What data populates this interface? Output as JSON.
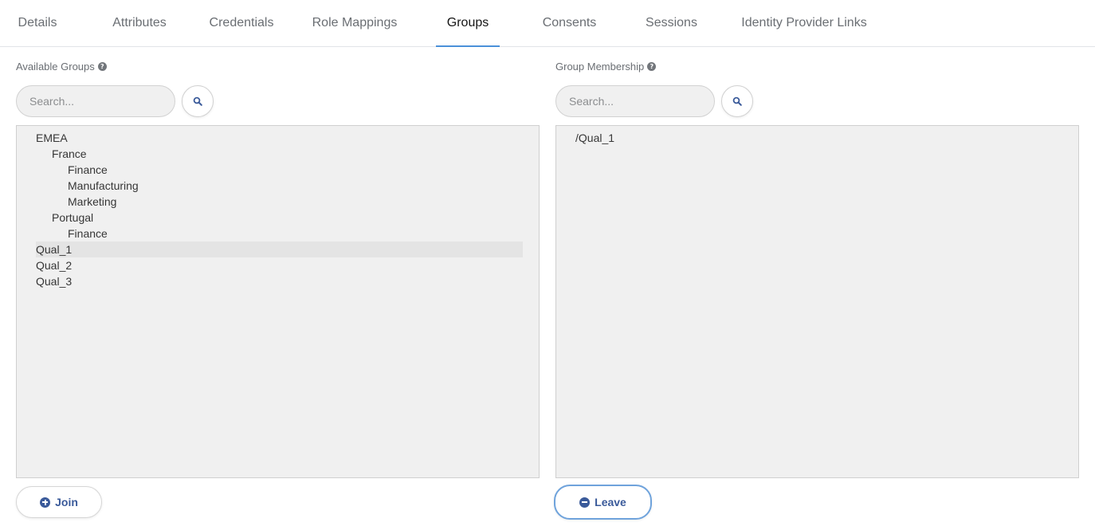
{
  "tabs": [
    {
      "label": "Details"
    },
    {
      "label": "Attributes"
    },
    {
      "label": "Credentials"
    },
    {
      "label": "Role Mappings"
    },
    {
      "label": "Groups",
      "active": true
    },
    {
      "label": "Consents"
    },
    {
      "label": "Sessions"
    },
    {
      "label": "Identity Provider Links"
    }
  ],
  "available_groups": {
    "label": "Available Groups",
    "help_icon": "question-circle-icon",
    "search_placeholder": "Search...",
    "search_icon": "search-icon",
    "items": [
      {
        "label": "EMEA",
        "depth": 0,
        "selected": false
      },
      {
        "label": "France",
        "depth": 1,
        "selected": false
      },
      {
        "label": "Finance",
        "depth": 2,
        "selected": false
      },
      {
        "label": "Manufacturing",
        "depth": 2,
        "selected": false
      },
      {
        "label": "Marketing",
        "depth": 2,
        "selected": false
      },
      {
        "label": "Portugal",
        "depth": 1,
        "selected": false
      },
      {
        "label": "Finance",
        "depth": 2,
        "selected": false
      },
      {
        "label": "Qual_1",
        "depth": 0,
        "selected": true
      },
      {
        "label": "Qual_2",
        "depth": 0,
        "selected": false
      },
      {
        "label": "Qual_3",
        "depth": 0,
        "selected": false
      }
    ],
    "action_label": "Join",
    "action_icon": "plus-circle-icon"
  },
  "group_membership": {
    "label": "Group Membership",
    "help_icon": "question-circle-icon",
    "search_placeholder": "Search...",
    "search_icon": "search-icon",
    "items": [
      {
        "label": "/Qual_1"
      }
    ],
    "action_label": "Leave",
    "action_icon": "minus-circle-icon"
  },
  "colors": {
    "accent": "#4a90d9",
    "button_text": "#3a5a9a",
    "list_background": "#f0f0f0",
    "selected_row": "#e4e4e4"
  }
}
